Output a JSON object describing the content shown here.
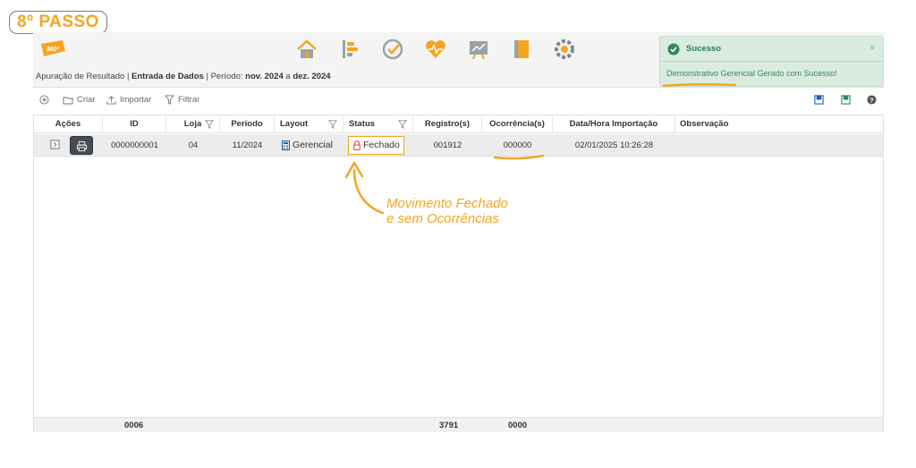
{
  "step_badge": "8º PASSO",
  "logo_text": "360º",
  "nav_icons": [
    "home-icon",
    "timeline-icon",
    "check-circle-icon",
    "heartbeat-icon",
    "chart-board-icon",
    "notebook-icon",
    "gear-network-icon"
  ],
  "breadcrumb": {
    "section": "Apuração de Resultado",
    "sep": "|",
    "page": "Entrada de Dados",
    "period_label": "Período:",
    "period_from": "nov. 2024",
    "period_to_word": "a",
    "period_to": "dez. 2024"
  },
  "toolbar": {
    "criar": "Criar",
    "importar": "Importar",
    "filtrar": "Filtrar"
  },
  "table": {
    "columns": [
      "Ações",
      "ID",
      "Loja",
      "Período",
      "Layout",
      "Status",
      "Registro(s)",
      "Ocorrência(s)",
      "Data/Hora Importação",
      "Observação"
    ],
    "row": {
      "id": "0000000001",
      "loja": "04",
      "periodo": "11/2024",
      "layout": "Gerencial",
      "status": "Fechado",
      "registros": "001912",
      "ocorrencias": "000000",
      "data_hora": "02/01/2025 10:26:28",
      "observacao": ""
    },
    "footer": {
      "count": "0006",
      "registros_total": "3791",
      "ocorrencias_total": "0000"
    }
  },
  "toast": {
    "title": "Sucesso",
    "message": "Demonstrativo Gerencial Gerado com Sucesso!",
    "close": "×"
  },
  "annotation": {
    "line1": "Movimento Fechado",
    "line2": "e sem Ocorrências"
  },
  "colors": {
    "accent_orange": "#f3a521",
    "success_green": "#2e8b57",
    "status_red": "#e0443a"
  }
}
